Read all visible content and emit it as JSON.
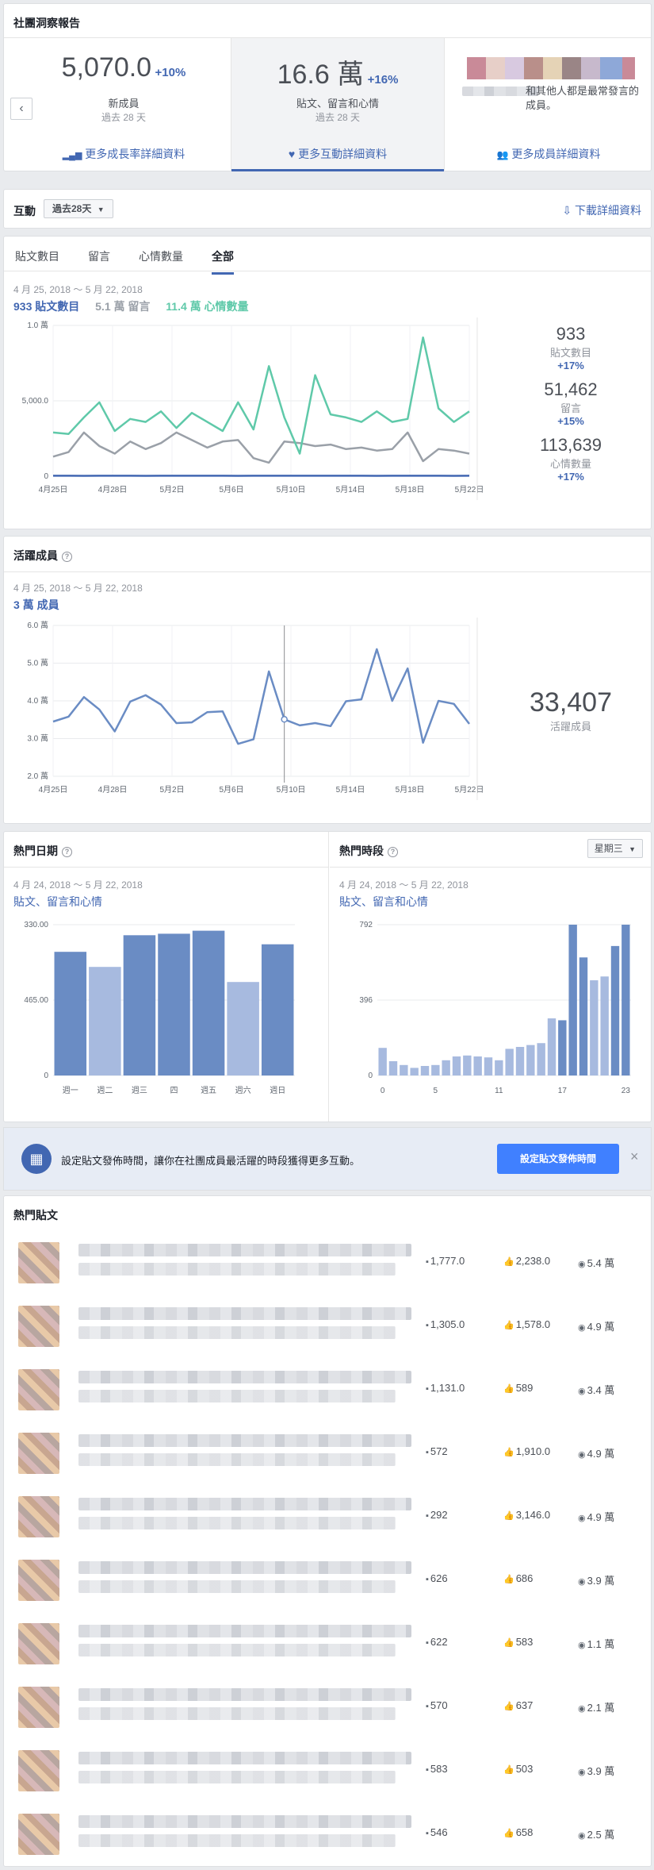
{
  "page_title": "社團洞察報告",
  "summary": [
    {
      "value": "5,070.0",
      "delta": "+10%",
      "label": "新成員",
      "period": "過去 28 天",
      "link": "更多成長率詳細資料"
    },
    {
      "value": "16.6 萬",
      "delta": "+16%",
      "label": "貼文、留言和心情",
      "period": "過去 28 天",
      "link": "更多互動詳細資料"
    },
    {
      "text": "和其他人都是最常發言的成員。",
      "link": "更多成員詳細資料"
    }
  ],
  "engagement": {
    "title": "互動",
    "range_select": "過去28天",
    "download": "下載詳細資料",
    "tabs": [
      "貼文數目",
      "留言",
      "心情數量",
      "全部"
    ],
    "active_tab": "全部",
    "date_range": "4 月 25, 2018 ～ 5 月 22, 2018",
    "legend": [
      {
        "text": "933 貼文數目",
        "color": "#4267b2"
      },
      {
        "text": "5.1 萬 留言",
        "color": "#9aa0a8"
      },
      {
        "text": "11.4 萬 心情數量",
        "color": "#5fc9a9"
      }
    ],
    "totals": [
      {
        "value": "933",
        "label": "貼文數目",
        "delta": "+17%"
      },
      {
        "value": "51,462",
        "label": "留言",
        "delta": "+15%"
      },
      {
        "value": "113,639",
        "label": "心情數量",
        "delta": "+17%"
      }
    ]
  },
  "active_members": {
    "title": "活躍成員",
    "date_range": "4 月 25, 2018 ～ 5 月 22, 2018",
    "subtitle": "3 萬 成員",
    "total": "33,407",
    "total_label": "活躍成員"
  },
  "popular_days": {
    "title": "熱門日期",
    "date_range": "4 月 24, 2018 ～ 5 月 22, 2018",
    "subtitle": "貼文、留言和心情"
  },
  "popular_times": {
    "title": "熱門時段",
    "day_select": "星期三",
    "date_range": "4 月 24, 2018 ～ 5 月 22, 2018",
    "subtitle": "貼文、留言和心情"
  },
  "banner": {
    "text": "設定貼文發佈時間，讓你在社團成員最活躍的時段獲得更多互動。",
    "button": "設定貼文發佈時間",
    "close": "×"
  },
  "top_posts": {
    "title": "熱門貼文",
    "posts": [
      {
        "comments": "1,777.0",
        "likes": "2,238.0",
        "views": "5.4 萬"
      },
      {
        "comments": "1,305.0",
        "likes": "1,578.0",
        "views": "4.9 萬"
      },
      {
        "comments": "1,131.0",
        "likes": "589",
        "views": "3.4 萬"
      },
      {
        "comments": "572",
        "likes": "1,910.0",
        "views": "4.9 萬"
      },
      {
        "comments": "292",
        "likes": "3,146.0",
        "views": "4.9 萬"
      },
      {
        "comments": "626",
        "likes": "686",
        "views": "3.9 萬"
      },
      {
        "comments": "622",
        "likes": "583",
        "views": "1.1 萬"
      },
      {
        "comments": "570",
        "likes": "637",
        "views": "2.1 萬"
      },
      {
        "comments": "583",
        "likes": "503",
        "views": "3.9 萬"
      },
      {
        "comments": "546",
        "likes": "658",
        "views": "2.5 萬"
      }
    ]
  },
  "chart_data": [
    {
      "type": "line",
      "x_tick_labels": [
        "4月25日",
        "4月28日",
        "5月2日",
        "5月6日",
        "5月10日",
        "5月14日",
        "5月18日",
        "5月22日"
      ],
      "y_tick_labels": [
        "1.0 萬",
        "5,000.0",
        "0"
      ],
      "ylim": [
        0,
        10000
      ],
      "series": [
        {
          "name": "貼文數目",
          "color": "#4267b2",
          "values": [
            30,
            35,
            28,
            33,
            30,
            32,
            29,
            31,
            34,
            36,
            33,
            30,
            29,
            35,
            32,
            31,
            30,
            33,
            34,
            30,
            31,
            28,
            32,
            30,
            33,
            31,
            29,
            32
          ]
        },
        {
          "name": "留言",
          "color": "#9aa0a8",
          "values": [
            1300,
            1600,
            2900,
            2000,
            1500,
            2300,
            1800,
            2200,
            2900,
            2400,
            1900,
            2300,
            2400,
            1200,
            900,
            2300,
            2200,
            2000,
            2100,
            1800,
            1900,
            1700,
            1800,
            2900,
            1000,
            1800,
            1700,
            1500
          ]
        },
        {
          "name": "心情數量",
          "color": "#5fc9a9",
          "values": [
            2900,
            2800,
            3900,
            4900,
            3000,
            3800,
            3600,
            4300,
            3200,
            4200,
            3600,
            3000,
            4900,
            3100,
            7300,
            3900,
            1500,
            6700,
            4100,
            3900,
            3600,
            4300,
            3600,
            3800,
            9200,
            4500,
            3600,
            4300
          ]
        }
      ]
    },
    {
      "type": "line",
      "x_tick_labels": [
        "4月25日",
        "4月28日",
        "5月2日",
        "5月6日",
        "5月10日",
        "5月14日",
        "5月18日",
        "5月22日"
      ],
      "y_tick_labels": [
        "6.0 萬",
        "5.0 萬",
        "4.0 萬",
        "3.0 萬",
        "2.0 萬"
      ],
      "ylim": [
        20000,
        60000
      ],
      "series": [
        {
          "name": "活躍成員",
          "color": "#6a8cc4",
          "values": [
            34500,
            35800,
            41000,
            37700,
            31900,
            39800,
            41500,
            39000,
            34100,
            34300,
            37000,
            37200,
            28600,
            29800,
            47800,
            35100,
            33500,
            34100,
            33300,
            39900,
            40400,
            53700,
            40000,
            48600,
            28900,
            40000,
            39200,
            33900
          ]
        }
      ]
    },
    {
      "type": "bar",
      "categories": [
        "週一",
        "週二",
        "週三",
        "四",
        "週五",
        "週六",
        "週日"
      ],
      "y_tick_labels": [
        "330.00",
        "465.00",
        "0"
      ],
      "values": [
        820,
        720,
        930,
        940,
        960,
        620,
        870
      ],
      "highlight": [
        true,
        false,
        true,
        true,
        true,
        false,
        true
      ]
    },
    {
      "type": "bar",
      "categories": [
        "0",
        "1",
        "2",
        "3",
        "4",
        "5",
        "6",
        "7",
        "8",
        "9",
        "10",
        "11",
        "12",
        "13",
        "14",
        "15",
        "16",
        "17",
        "18",
        "19",
        "20",
        "21",
        "22",
        "23"
      ],
      "x_tick_labels": [
        "0",
        "5",
        "11",
        "17",
        "23"
      ],
      "y_tick_labels": [
        "792",
        "396",
        "0"
      ],
      "values": [
        145,
        75,
        55,
        40,
        50,
        55,
        80,
        100,
        105,
        100,
        95,
        80,
        140,
        150,
        160,
        170,
        300,
        290,
        792,
        620,
        500,
        520,
        680,
        792
      ],
      "highlight": [
        false,
        false,
        false,
        false,
        false,
        false,
        false,
        false,
        false,
        false,
        false,
        false,
        false,
        false,
        false,
        false,
        false,
        true,
        true,
        true,
        false,
        false,
        true,
        true
      ]
    }
  ]
}
